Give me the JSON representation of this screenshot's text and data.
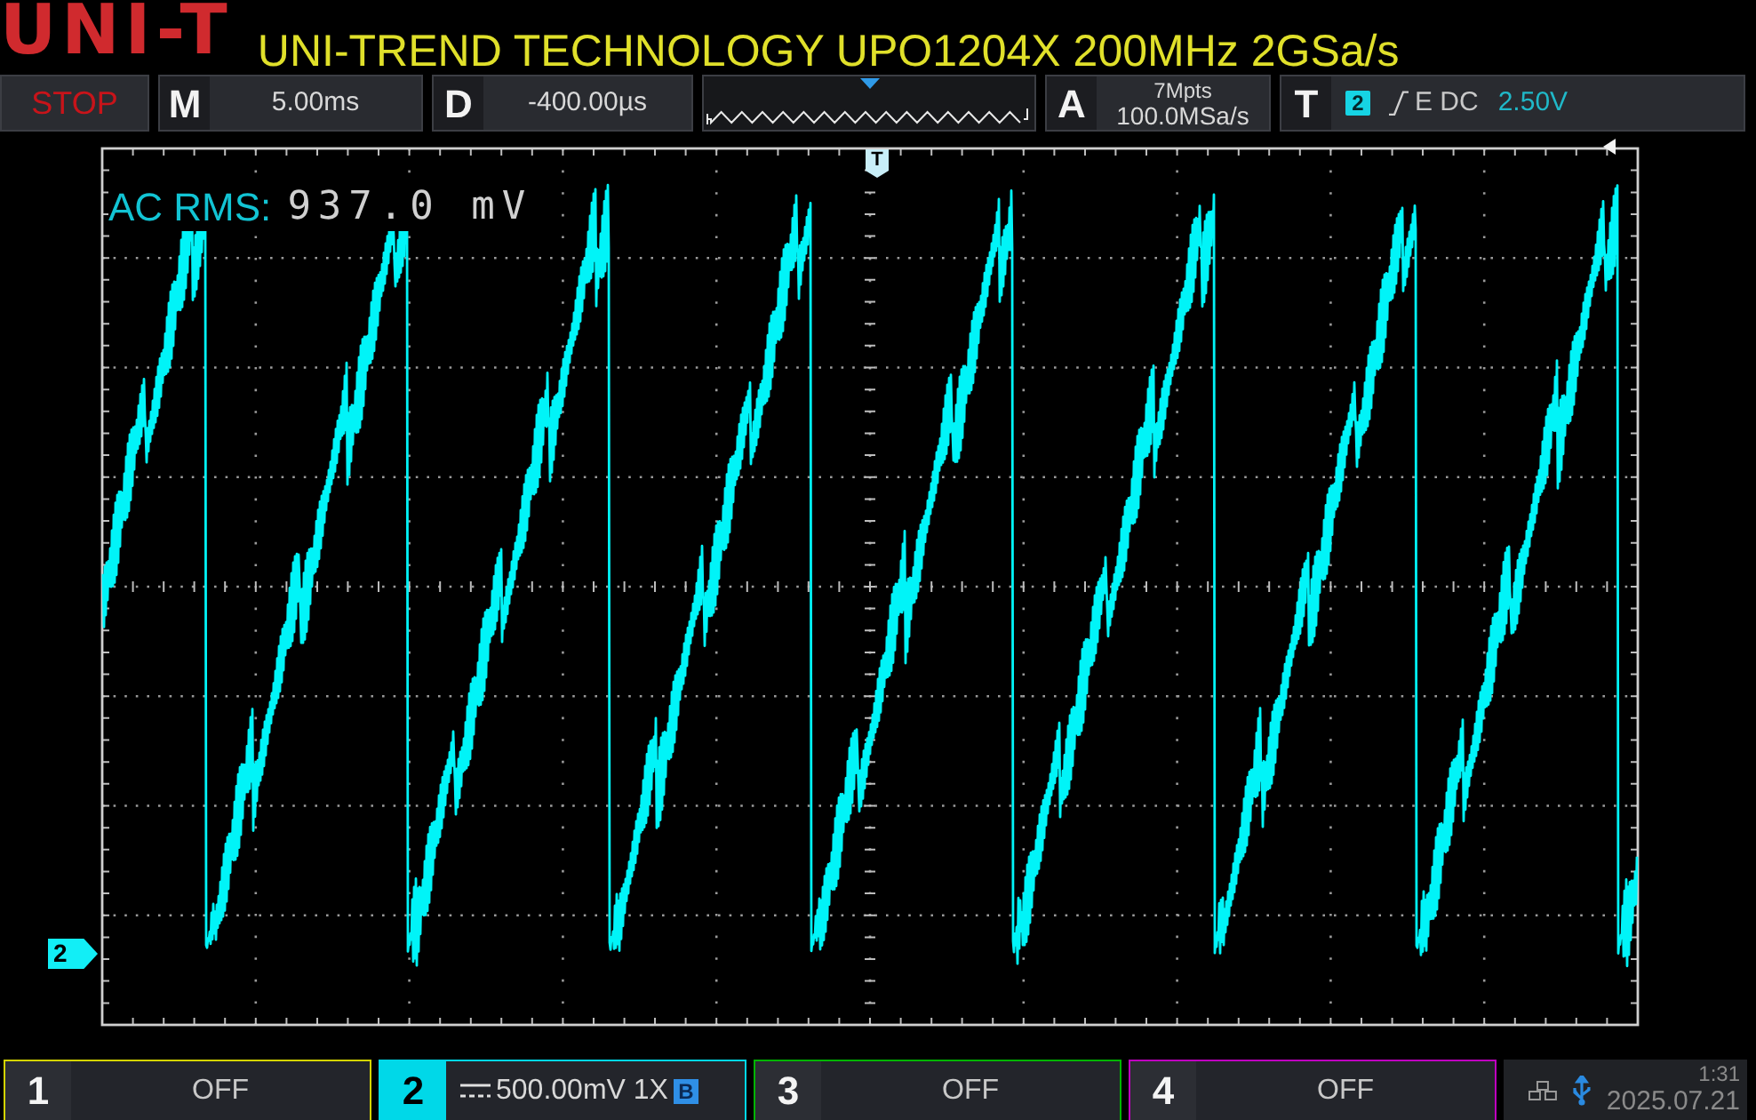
{
  "header": {
    "logo": "UNI-T",
    "title": "UNI-TREND TECHNOLOGY UPO1204X 200MHz 2GSa/s"
  },
  "toolbar": {
    "run_state": "STOP",
    "timebase": {
      "label": "M",
      "value": "5.00ms"
    },
    "delay": {
      "label": "D",
      "value": "-400.00µs"
    },
    "acquisition": {
      "label": "A",
      "memory_depth": "7Mpts",
      "sample_rate": "100.0MSa/s"
    },
    "trigger": {
      "label": "T",
      "source": "2",
      "coupling": "E DC",
      "level": "2.50V"
    }
  },
  "screen": {
    "trigger_position_marker": "T",
    "channel_marker": "2",
    "measurement": {
      "label": "AC RMS:",
      "value": "937.0 mV"
    }
  },
  "channels": [
    {
      "number": "1",
      "color": "#d4d400",
      "on": false,
      "text": "OFF"
    },
    {
      "number": "2",
      "color": "#00d8e8",
      "on": true,
      "text": "500.00mV 1X",
      "badge": "B"
    },
    {
      "number": "3",
      "color": "#00b400",
      "on": false,
      "text": "OFF"
    },
    {
      "number": "4",
      "color": "#c000c0",
      "on": false,
      "text": "OFF"
    }
  ],
  "status": {
    "time": "1:31",
    "date": "2025.07.21"
  }
}
